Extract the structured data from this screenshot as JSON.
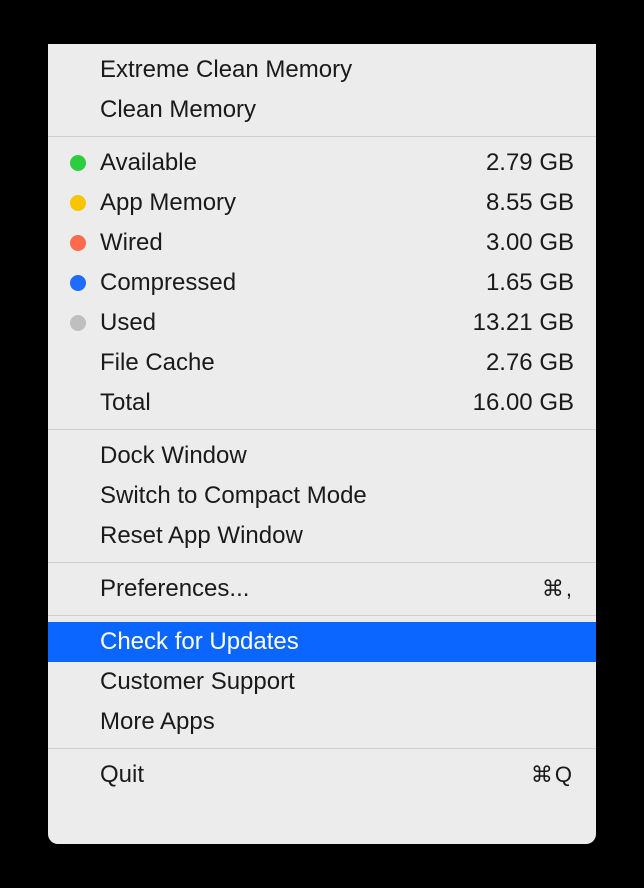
{
  "section1": {
    "items": [
      {
        "label": "Extreme Clean Memory"
      },
      {
        "label": "Clean Memory"
      }
    ]
  },
  "memory": {
    "rows": [
      {
        "label": "Available",
        "value": "2.79 GB",
        "dot": "#2ecc40"
      },
      {
        "label": "App Memory",
        "value": "8.55 GB",
        "dot": "#f7c600"
      },
      {
        "label": "Wired",
        "value": "3.00 GB",
        "dot": "#ff6a4d"
      },
      {
        "label": "Compressed",
        "value": "1.65 GB",
        "dot": "#1f6bff"
      },
      {
        "label": "Used",
        "value": "13.21 GB",
        "dot": "#bfbfbf"
      },
      {
        "label": "File Cache",
        "value": "2.76 GB",
        "dot": null
      },
      {
        "label": "Total",
        "value": "16.00 GB",
        "dot": null
      }
    ]
  },
  "section3": {
    "items": [
      {
        "label": "Dock Window"
      },
      {
        "label": "Switch to Compact Mode"
      },
      {
        "label": "Reset App Window"
      }
    ]
  },
  "section4": {
    "items": [
      {
        "label": "Preferences...",
        "shortcut": "⌘,"
      }
    ]
  },
  "section5": {
    "items": [
      {
        "label": "Check for Updates",
        "highlight": true
      },
      {
        "label": "Customer Support"
      },
      {
        "label": "More Apps"
      }
    ]
  },
  "section6": {
    "items": [
      {
        "label": "Quit",
        "shortcut": "⌘Q"
      }
    ]
  }
}
